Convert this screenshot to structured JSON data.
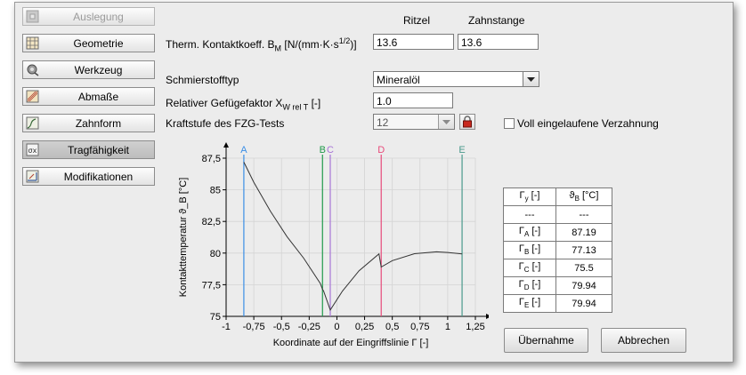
{
  "sidebar": {
    "items": [
      {
        "label": "Auslegung",
        "icon": "gear-box-icon",
        "disabled": true
      },
      {
        "label": "Geometrie",
        "icon": "grid-icon"
      },
      {
        "label": "Werkzeug",
        "icon": "gear-tool-icon"
      },
      {
        "label": "Abmaße",
        "icon": "dimension-icon"
      },
      {
        "label": "Zahnform",
        "icon": "tooth-form-icon"
      },
      {
        "label": "Tragfähigkeit",
        "icon": "sigma-icon",
        "selected": true
      },
      {
        "label": "Modifikationen",
        "icon": "modification-icon"
      }
    ]
  },
  "form": {
    "col_ritzel": "Ritzel",
    "col_zahnstange": "Zahnstange",
    "therm_label": "Therm. Kontaktkoeff. B",
    "therm_sub": "M",
    "therm_unit_a": "[N/(mm·K·s",
    "therm_unit_sup": "1/2",
    "therm_unit_b": ")]",
    "therm_ritzel": "13.6",
    "therm_zahnstange": "13.6",
    "schmier_label": "Schmierstofftyp",
    "schmier_value": "Mineralöl",
    "gefuege_label": "Relativer Gefügefaktor X",
    "gefuege_sub": "W rel T",
    "gefuege_unit": "[-]",
    "gefuege_value": "1.0",
    "kraft_label": "Kraftstufe des FZG-Tests",
    "kraft_value": "12",
    "voll_label": "Voll eingelaufene Verzahnung",
    "voll_checked": false
  },
  "chart_data": {
    "type": "line",
    "ylabel": "Kontakttemperatur ϑ_B [°C]",
    "xlabel": "Koordinate auf der Eingriffslinie Γ [-]",
    "xlim": [
      -1,
      1.25
    ],
    "ylim": [
      75,
      87.5
    ],
    "xticks": [
      "-1",
      "-0,75",
      "-0,5",
      "-0,25",
      "0",
      "0,25",
      "0,5",
      "0,75",
      "1",
      "1,25"
    ],
    "yticks": [
      "75",
      "77,5",
      "80",
      "82,5",
      "85",
      "87,5"
    ],
    "series": [
      {
        "x": [
          -0.84,
          -0.75,
          -0.6,
          -0.45,
          -0.3,
          -0.15,
          -0.13,
          -0.12,
          -0.06,
          0.05,
          0.2,
          0.38,
          0.4,
          0.5,
          0.7,
          0.9,
          1.0,
          1.13
        ],
        "y": [
          87.19,
          85.6,
          83.3,
          81.3,
          79.6,
          77.6,
          77.13,
          77.0,
          75.5,
          77.0,
          78.6,
          79.94,
          78.9,
          79.4,
          79.95,
          80.1,
          80.05,
          79.94
        ]
      }
    ],
    "markers": [
      {
        "label": "A",
        "x": -0.84,
        "color": "#3a8ee6"
      },
      {
        "label": "B",
        "x": -0.13,
        "color": "#1f9a4a"
      },
      {
        "label": "C",
        "x": -0.06,
        "color": "#a774d6"
      },
      {
        "label": "D",
        "x": 0.4,
        "color": "#e84a7a"
      },
      {
        "label": "E",
        "x": 1.13,
        "color": "#4a9a8c"
      }
    ]
  },
  "table": {
    "h1": "Γ",
    "h1_sub": "y",
    "h1_unit": "[-]",
    "h2": "ϑ",
    "h2_sub": "B",
    "h2_unit": "[°C]",
    "units_row": [
      "---",
      "---"
    ],
    "rows": [
      {
        "sub": "A",
        "value": "87.19"
      },
      {
        "sub": "B",
        "value": "77.13"
      },
      {
        "sub": "C",
        "value": "75.5"
      },
      {
        "sub": "D",
        "value": "79.94"
      },
      {
        "sub": "E",
        "value": "79.94"
      }
    ],
    "row_prefix": "Γ",
    "row_unit": "[-]"
  },
  "buttons": {
    "apply": "Übernahme",
    "cancel": "Abbrechen"
  }
}
